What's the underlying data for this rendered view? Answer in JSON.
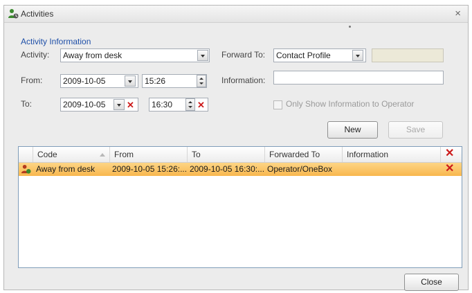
{
  "window": {
    "title": "Activities",
    "close_glyph": "×"
  },
  "activity_info": {
    "group_title": "Activity Information",
    "activity_label": "Activity:",
    "activity_value": "Away from desk",
    "from_label": "From:",
    "from_date": "2009-10-05",
    "from_time": "15:26",
    "to_label": "To:",
    "to_date": "2009-10-05",
    "to_time": "16:30",
    "forward_to_label": "Forward To:",
    "forward_to_value": "Contact Profile",
    "forward_to_extra": "",
    "information_label": "Information:",
    "information_value": "",
    "only_show_label": "Only Show Information to Operator",
    "clear_glyph": "✕"
  },
  "buttons": {
    "new": "New",
    "save": "Save",
    "close": "Close"
  },
  "grid": {
    "columns": [
      "Code",
      "From",
      "To",
      "Forwarded To",
      "Information"
    ],
    "delete_all_glyph": "✕",
    "rows": [
      {
        "code": "Away from desk",
        "from": "2009-10-05 15:26:...",
        "to": "2009-10-05 16:30:...",
        "forwarded_to": "Operator/OneBox",
        "information": "",
        "delete_glyph": "✕"
      }
    ]
  },
  "colors": {
    "selected_row": "#f8b74e",
    "accent": "#1e4fa8",
    "delete": "#cc1a1a"
  }
}
